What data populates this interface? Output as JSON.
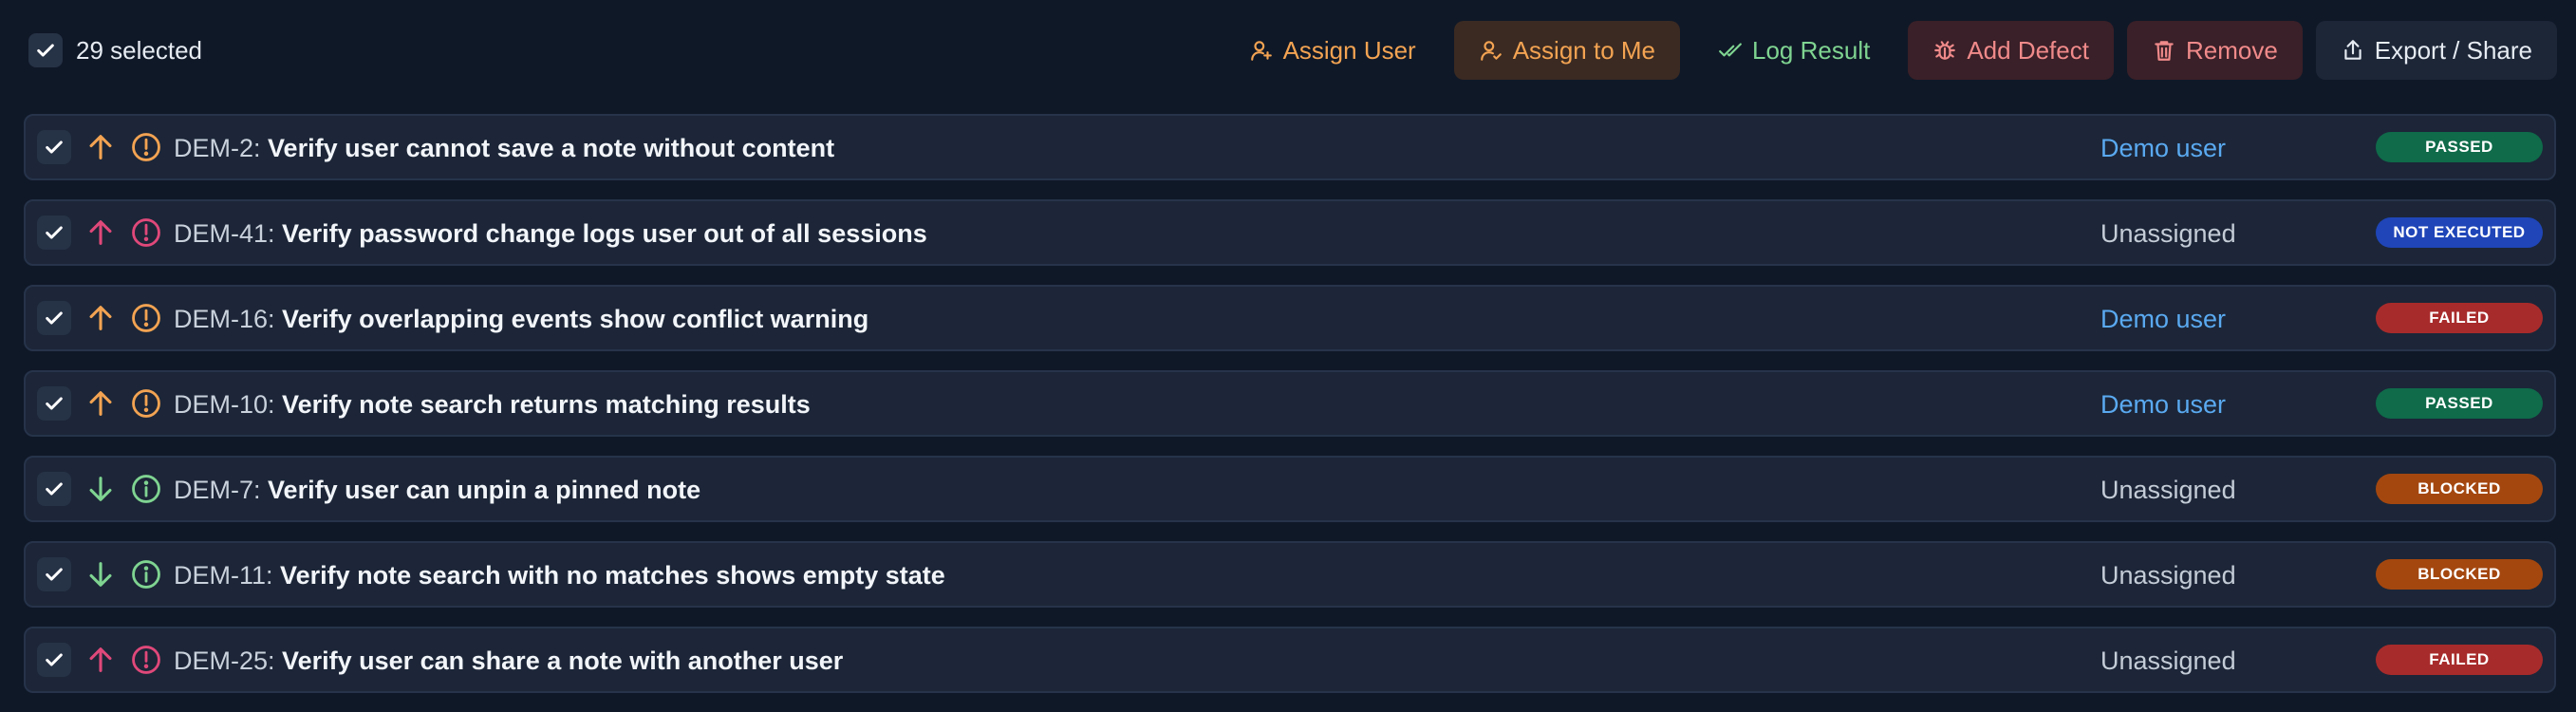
{
  "toolbar": {
    "selection_label": "29 selected",
    "actions": [
      {
        "label": "Assign User",
        "icon": "user-plus-icon"
      },
      {
        "label": "Assign to Me",
        "icon": "user-check-icon"
      },
      {
        "label": "Log Result",
        "icon": "double-check-icon"
      },
      {
        "label": "Add Defect",
        "icon": "bug-icon"
      },
      {
        "label": "Remove",
        "icon": "trash-icon"
      },
      {
        "label": "Export / Share",
        "icon": "share-icon"
      }
    ]
  },
  "colors": {
    "background": "#0f1827",
    "row_background": "#1c2638",
    "high_priority": "#f3a352",
    "critical_priority": "#e0487a",
    "low_priority": "#7fd491",
    "assignee_link": "#5aa9f0",
    "passed": "#0f6b4a",
    "not_executed": "#1f45b8",
    "failed": "#a82b2b",
    "blocked": "#a4470f"
  },
  "rows": [
    {
      "key": "DEM-2:",
      "title": "Verify user cannot save a note without content",
      "direction": "up",
      "priority": "high",
      "assignee": "Demo user",
      "assigned": true,
      "status": "PASSED"
    },
    {
      "key": "DEM-41:",
      "title": "Verify password change logs user out of all sessions",
      "direction": "up",
      "priority": "critical",
      "assignee": "Unassigned",
      "assigned": false,
      "status": "NOT EXECUTED"
    },
    {
      "key": "DEM-16:",
      "title": "Verify overlapping events show conflict warning",
      "direction": "up",
      "priority": "high",
      "assignee": "Demo user",
      "assigned": true,
      "status": "FAILED"
    },
    {
      "key": "DEM-10:",
      "title": "Verify note search returns matching results",
      "direction": "up",
      "priority": "high",
      "assignee": "Demo user",
      "assigned": true,
      "status": "PASSED"
    },
    {
      "key": "DEM-7:",
      "title": "Verify user can unpin a pinned note",
      "direction": "down",
      "priority": "low",
      "assignee": "Unassigned",
      "assigned": false,
      "status": "BLOCKED"
    },
    {
      "key": "DEM-11:",
      "title": "Verify note search with no matches shows empty state",
      "direction": "down",
      "priority": "low",
      "assignee": "Unassigned",
      "assigned": false,
      "status": "BLOCKED"
    },
    {
      "key": "DEM-25:",
      "title": "Verify user can share a note with another user",
      "direction": "up",
      "priority": "critical",
      "assignee": "Unassigned",
      "assigned": false,
      "status": "FAILED"
    }
  ]
}
